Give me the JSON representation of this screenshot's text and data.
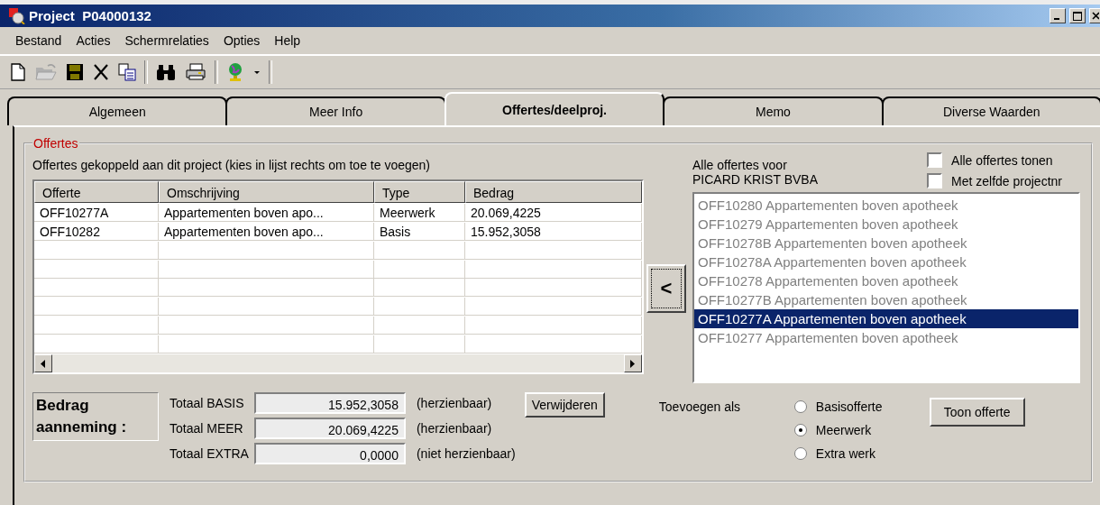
{
  "window": {
    "title": "Project  P04000132"
  },
  "menu": [
    "Bestand",
    "Acties",
    "Schermrelaties",
    "Opties",
    "Help"
  ],
  "tabs": [
    {
      "label": "Algemeen",
      "selected": false
    },
    {
      "label": "Meer Info",
      "selected": false
    },
    {
      "label": "Offertes/deelproj.",
      "selected": true
    },
    {
      "label": "Memo",
      "selected": false
    },
    {
      "label": "Diverse Waarden",
      "selected": false
    }
  ],
  "group": {
    "title": "Offertes"
  },
  "linked": {
    "caption": "Offertes gekoppeld aan dit project (kies in lijst rechts om toe te voegen)",
    "columns": [
      "Offerte",
      "Omschrijving",
      "Type",
      "Bedrag"
    ],
    "rows": [
      [
        "OFF10277A",
        "Appartementen boven apo...",
        "Meerwerk",
        "20.069,4225"
      ],
      [
        "OFF10282",
        "Appartementen boven apo...",
        "Basis",
        "15.952,3058"
      ]
    ]
  },
  "move_button": "<",
  "available": {
    "caption": "Alle offertes voor",
    "customer": "PICARD KRIST BVBA",
    "options": [
      {
        "label": "Alle offertes tonen",
        "checked": false
      },
      {
        "label": "Met zelfde projectnr",
        "checked": false
      }
    ],
    "items": [
      {
        "text": "OFF10280 Appartementen boven apotheek",
        "selected": false
      },
      {
        "text": "OFF10279 Appartementen boven apotheek",
        "selected": false
      },
      {
        "text": "OFF10278B Appartementen boven apotheek",
        "selected": false
      },
      {
        "text": "OFF10278A Appartementen boven apotheek",
        "selected": false
      },
      {
        "text": "OFF10278 Appartementen boven apotheek",
        "selected": false
      },
      {
        "text": "OFF10277B Appartementen boven apotheek",
        "selected": false
      },
      {
        "text": "OFF10277A Appartementen boven apotheek",
        "selected": true
      },
      {
        "text": "OFF10277 Appartementen boven apotheek",
        "selected": false
      }
    ]
  },
  "totals": {
    "title": "Bedrag aanneming :",
    "rows": [
      {
        "label": "Totaal BASIS",
        "value": "15.952,3058",
        "note": "(herzienbaar)"
      },
      {
        "label": "Totaal MEER",
        "value": "20.069,4225",
        "note": "(herzienbaar)"
      },
      {
        "label": "Totaal EXTRA",
        "value": "0,0000",
        "note": "(niet herzienbaar)"
      }
    ]
  },
  "remove_button": "Verwijderen",
  "add_as": {
    "label": "Toevoegen als",
    "options": [
      {
        "label": "Basisofferte",
        "selected": false
      },
      {
        "label": "Meerwerk",
        "selected": true
      },
      {
        "label": "Extra werk",
        "selected": false
      }
    ]
  },
  "show_button": "Toon offerte"
}
